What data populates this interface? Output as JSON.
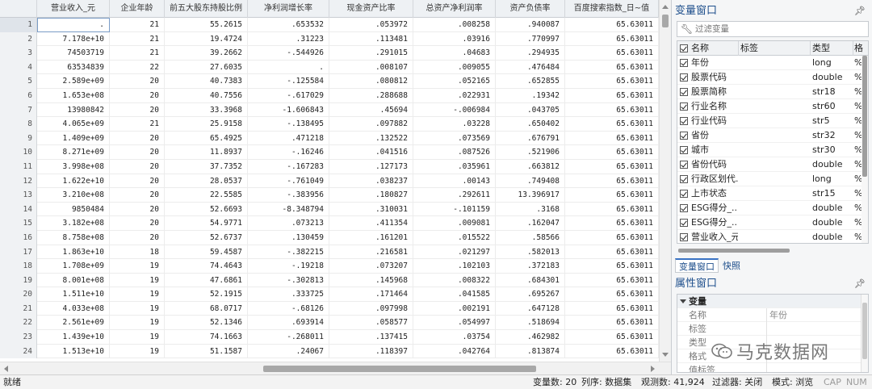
{
  "grid": {
    "columns": [
      "营业收入_元",
      "企业年龄",
      "前五大股东持股比例",
      "净利润增长率",
      "现金资产比率",
      "总资产净利润率",
      "资产负债率",
      "百度搜索指数_日~值"
    ],
    "rows": [
      [
        "1",
        ".",
        "21",
        "55.2615",
        ".653532",
        ".053972",
        ".008258",
        ".940087",
        "65.63011"
      ],
      [
        "2",
        "7.178e+10",
        "21",
        "19.4724",
        ".31223",
        ".113481",
        ".03916",
        ".770997",
        "65.63011"
      ],
      [
        "3",
        "74503719",
        "21",
        "39.2662",
        "-.544926",
        ".291015",
        ".04683",
        ".294935",
        "65.63011"
      ],
      [
        "4",
        "63534839",
        "22",
        "27.6035",
        ".",
        ".008107",
        ".009055",
        ".476484",
        "65.63011"
      ],
      [
        "5",
        "2.589e+09",
        "20",
        "40.7383",
        "-.125584",
        ".080812",
        ".052165",
        ".652855",
        "65.63011"
      ],
      [
        "6",
        "1.653e+08",
        "20",
        "40.7556",
        "-.617029",
        ".288688",
        ".022931",
        ".19342",
        "65.63011"
      ],
      [
        "7",
        "13980842",
        "20",
        "33.3968",
        "-1.606843",
        ".45694",
        "-.006984",
        ".043705",
        "65.63011"
      ],
      [
        "8",
        "4.065e+09",
        "21",
        "25.9158",
        "-.138495",
        ".097882",
        ".03228",
        ".650402",
        "65.63011"
      ],
      [
        "9",
        "1.409e+09",
        "20",
        "65.4925",
        ".471218",
        ".132522",
        ".073569",
        ".676791",
        "65.63011"
      ],
      [
        "10",
        "8.271e+09",
        "20",
        "11.8937",
        "-.16246",
        ".041516",
        ".087526",
        ".521906",
        "65.63011"
      ],
      [
        "11",
        "3.998e+08",
        "20",
        "37.7352",
        "-.167283",
        ".127173",
        ".035961",
        ".663812",
        "65.63011"
      ],
      [
        "12",
        "1.622e+10",
        "20",
        "28.0537",
        "-.761049",
        ".038237",
        ".00143",
        ".749408",
        "65.63011"
      ],
      [
        "13",
        "3.210e+08",
        "20",
        "22.5585",
        "-.383956",
        ".180827",
        ".292611",
        "13.396917",
        "65.63011"
      ],
      [
        "14",
        "9850484",
        "20",
        "52.6693",
        "-8.348794",
        ".310031",
        "-.101159",
        ".3168",
        "65.63011"
      ],
      [
        "15",
        "3.182e+08",
        "20",
        "54.9771",
        ".073213",
        ".411354",
        ".009081",
        ".162047",
        "65.63011"
      ],
      [
        "16",
        "8.758e+08",
        "20",
        "52.6737",
        ".130459",
        ".161201",
        ".015522",
        ".58566",
        "65.63011"
      ],
      [
        "17",
        "1.863e+10",
        "18",
        "59.4587",
        "-.382215",
        ".216581",
        ".021297",
        ".582013",
        "65.63011"
      ],
      [
        "18",
        "1.708e+09",
        "19",
        "74.4643",
        "-.19218",
        ".073207",
        ".102103",
        ".372183",
        "65.63011"
      ],
      [
        "19",
        "8.001e+08",
        "19",
        "47.6861",
        "-.302813",
        ".145968",
        ".008322",
        ".684301",
        "65.63011"
      ],
      [
        "20",
        "1.511e+10",
        "19",
        "52.1915",
        ".333725",
        ".171464",
        ".041585",
        ".695267",
        "65.63011"
      ],
      [
        "21",
        "4.033e+08",
        "19",
        "68.0717",
        "-.68126",
        ".097998",
        ".002191",
        ".647128",
        "65.63011"
      ],
      [
        "22",
        "2.561e+09",
        "19",
        "52.1346",
        ".693914",
        ".058577",
        ".054997",
        ".518694",
        "65.63011"
      ],
      [
        "23",
        "1.439e+10",
        "19",
        "74.1663",
        "-.268011",
        ".137415",
        ".03754",
        ".462982",
        "65.63011"
      ],
      [
        "24",
        "1.513e+10",
        "19",
        "51.1587",
        ".24067",
        ".118397",
        ".042764",
        ".813874",
        "65.63011"
      ]
    ]
  },
  "variables_panel": {
    "title": "变量窗口",
    "pin_icon": "pin-icon",
    "filter_placeholder": "过滤变量",
    "filter_icon": "wrench-icon",
    "headers": {
      "name": "名称",
      "label": "标签",
      "type": "类型",
      "format": "格"
    },
    "variables": [
      {
        "name": "年份",
        "label": "",
        "type": "long",
        "format": "%"
      },
      {
        "name": "股票代码",
        "label": "",
        "type": "double",
        "format": "%"
      },
      {
        "name": "股票简称",
        "label": "",
        "type": "str18",
        "format": "%"
      },
      {
        "name": "行业名称",
        "label": "",
        "type": "str60",
        "format": "%"
      },
      {
        "name": "行业代码",
        "label": "",
        "type": "str5",
        "format": "%"
      },
      {
        "name": "省份",
        "label": "",
        "type": "str32",
        "format": "%"
      },
      {
        "name": "城市",
        "label": "",
        "type": "str30",
        "format": "%"
      },
      {
        "name": "省份代码",
        "label": "",
        "type": "double",
        "format": "%"
      },
      {
        "name": "行政区划代...",
        "label": "",
        "type": "long",
        "format": "%"
      },
      {
        "name": "上市状态",
        "label": "",
        "type": "str15",
        "format": "%"
      },
      {
        "name": "ESG得分_...",
        "label": "",
        "type": "double",
        "format": "%"
      },
      {
        "name": "ESG得分_...",
        "label": "",
        "type": "double",
        "format": "%"
      },
      {
        "name": "营业收入_元",
        "label": "",
        "type": "double",
        "format": "%"
      }
    ],
    "tabs": [
      "变量窗口",
      "快照"
    ]
  },
  "properties_panel": {
    "title": "属性窗口",
    "group": "变量",
    "rows": [
      {
        "key": "名称",
        "value": "年份"
      },
      {
        "key": "标签",
        "value": ""
      },
      {
        "key": "类型",
        "value": ""
      },
      {
        "key": "格式",
        "value": ""
      },
      {
        "key": "值标签",
        "value": ""
      }
    ]
  },
  "watermark": {
    "text": "马克数据网",
    "icon": "wechat-icon"
  },
  "status_bar": {
    "ready": "就绪",
    "var_count": "变量数: 20",
    "sort": "列序: 数据集",
    "obs": "观测数: 41,924",
    "filter": "过滤器: 关闭",
    "mode": "模式: 浏览",
    "cap": "CAP",
    "num": "NUM"
  }
}
